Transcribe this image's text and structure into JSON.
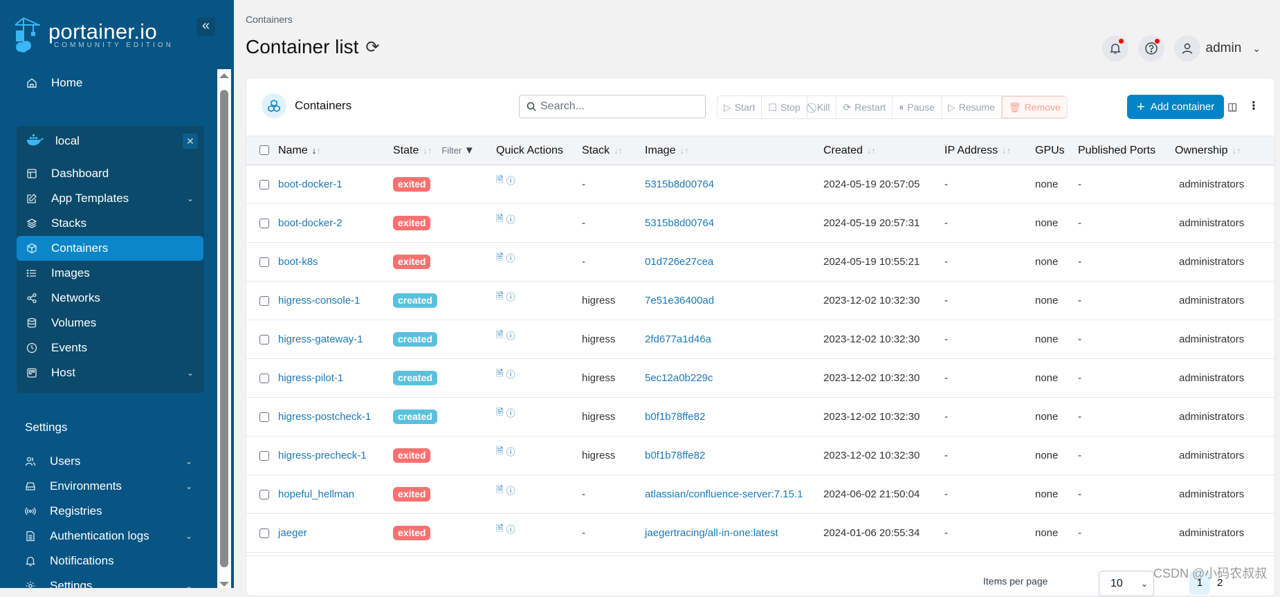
{
  "app": {
    "logo_main": "portainer.io",
    "logo_sub": "COMMUNITY EDITION"
  },
  "sidebar": {
    "home_label": "Home",
    "environment": {
      "name": "local"
    },
    "env_items": [
      {
        "label": "Dashboard",
        "icon": "dashboard-icon",
        "has_chevron": false
      },
      {
        "label": "App Templates",
        "icon": "edit-icon",
        "has_chevron": true
      },
      {
        "label": "Stacks",
        "icon": "layers-icon",
        "has_chevron": false
      },
      {
        "label": "Containers",
        "icon": "box-icon",
        "has_chevron": false,
        "active": true
      },
      {
        "label": "Images",
        "icon": "list-icon",
        "has_chevron": false
      },
      {
        "label": "Networks",
        "icon": "share-icon",
        "has_chevron": false
      },
      {
        "label": "Volumes",
        "icon": "database-icon",
        "has_chevron": false
      },
      {
        "label": "Events",
        "icon": "clock-icon",
        "has_chevron": false
      },
      {
        "label": "Host",
        "icon": "host-icon",
        "has_chevron": true
      }
    ],
    "settings_title": "Settings",
    "settings_items": [
      {
        "label": "Users",
        "icon": "users-icon",
        "has_chevron": true
      },
      {
        "label": "Environments",
        "icon": "hard-drive-icon",
        "has_chevron": true
      },
      {
        "label": "Registries",
        "icon": "radio-icon",
        "has_chevron": false
      },
      {
        "label": "Authentication logs",
        "icon": "file-text-icon",
        "has_chevron": true
      },
      {
        "label": "Notifications",
        "icon": "bell-icon",
        "has_chevron": false
      },
      {
        "label": "Settings",
        "icon": "gear-icon",
        "has_chevron": true
      }
    ]
  },
  "header": {
    "breadcrumb": "Containers",
    "title": "Container list",
    "user": "admin"
  },
  "card": {
    "title": "Containers",
    "search_placeholder": "Search...",
    "search_value": "",
    "actions": {
      "start": "Start",
      "stop": "Stop",
      "kill": "Kill",
      "restart": "Restart",
      "pause": "Pause",
      "resume": "Resume",
      "remove": "Remove"
    },
    "add_label": "Add container"
  },
  "table": {
    "headers": {
      "name": "Name",
      "state": "State",
      "filter": "Filter",
      "quick_actions": "Quick Actions",
      "stack": "Stack",
      "image": "Image",
      "created": "Created",
      "ip": "IP Address",
      "gpus": "GPUs",
      "ports": "Published Ports",
      "ownership": "Ownership"
    },
    "rows": [
      {
        "name": "boot-docker-1",
        "state": "exited",
        "stack": "-",
        "image": "5315b8d00764",
        "created": "2024-05-19 20:57:05",
        "ip": "-",
        "gpus": "none",
        "ports": "-",
        "ownership": "administrators"
      },
      {
        "name": "boot-docker-2",
        "state": "exited",
        "stack": "-",
        "image": "5315b8d00764",
        "created": "2024-05-19 20:57:31",
        "ip": "-",
        "gpus": "none",
        "ports": "-",
        "ownership": "administrators"
      },
      {
        "name": "boot-k8s",
        "state": "exited",
        "stack": "-",
        "image": "01d726e27cea",
        "created": "2024-05-19 10:55:21",
        "ip": "-",
        "gpus": "none",
        "ports": "-",
        "ownership": "administrators"
      },
      {
        "name": "higress-console-1",
        "state": "created",
        "stack": "higress",
        "image": "7e51e36400ad",
        "created": "2023-12-02 10:32:30",
        "ip": "-",
        "gpus": "none",
        "ports": "-",
        "ownership": "administrators"
      },
      {
        "name": "higress-gateway-1",
        "state": "created",
        "stack": "higress",
        "image": "2fd677a1d46a",
        "created": "2023-12-02 10:32:30",
        "ip": "-",
        "gpus": "none",
        "ports": "-",
        "ownership": "administrators"
      },
      {
        "name": "higress-pilot-1",
        "state": "created",
        "stack": "higress",
        "image": "5ec12a0b229c",
        "created": "2023-12-02 10:32:30",
        "ip": "-",
        "gpus": "none",
        "ports": "-",
        "ownership": "administrators"
      },
      {
        "name": "higress-postcheck-1",
        "state": "created",
        "stack": "higress",
        "image": "b0f1b78ffe82",
        "created": "2023-12-02 10:32:30",
        "ip": "-",
        "gpus": "none",
        "ports": "-",
        "ownership": "administrators"
      },
      {
        "name": "higress-precheck-1",
        "state": "exited",
        "stack": "higress",
        "image": "b0f1b78ffe82",
        "created": "2023-12-02 10:32:30",
        "ip": "-",
        "gpus": "none",
        "ports": "-",
        "ownership": "administrators"
      },
      {
        "name": "hopeful_hellman",
        "state": "exited",
        "stack": "-",
        "image": "atlassian/confluence-server:7.15.1",
        "created": "2024-06-02 21:50:04",
        "ip": "-",
        "gpus": "none",
        "ports": "-",
        "ownership": "administrators"
      },
      {
        "name": "jaeger",
        "state": "exited",
        "stack": "-",
        "image": "jaegertracing/all-in-one:latest",
        "created": "2024-01-06 20:55:34",
        "ip": "-",
        "gpus": "none",
        "ports": "-",
        "ownership": "administrators"
      }
    ]
  },
  "footer": {
    "items_per_page_label": "Items per page",
    "items_per_page": "10",
    "pages": [
      "1",
      "2"
    ],
    "current_page": "1"
  },
  "watermark": "CSDN @小码农叔叔",
  "colors": {
    "sidebar_bg": "#075584",
    "accent": "#0284c7",
    "exited": "#f87171",
    "created": "#5bc0de",
    "link": "#1b79b8"
  }
}
